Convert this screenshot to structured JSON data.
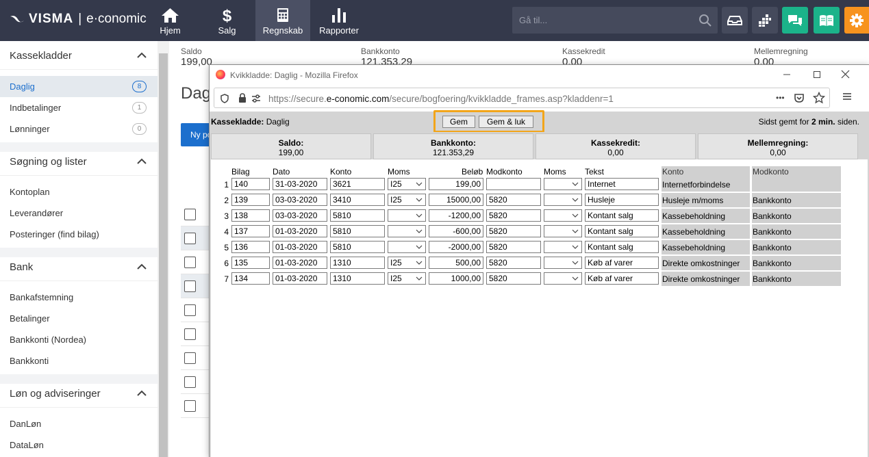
{
  "brand": {
    "visma": "VISMA",
    "sep": "|",
    "product": "e·conomic"
  },
  "nav": [
    {
      "label": "Hjem",
      "icon": "home-icon"
    },
    {
      "label": "Salg",
      "icon": "dollar-icon"
    },
    {
      "label": "Regnskab",
      "icon": "calculator-icon"
    },
    {
      "label": "Rapporter",
      "icon": "bar-chart-icon"
    }
  ],
  "search": {
    "placeholder": "Gå til..."
  },
  "sidebar": {
    "sections": [
      {
        "title": "Kassekladder",
        "items": [
          {
            "label": "Daglig",
            "badge": "8"
          },
          {
            "label": "Indbetalinger",
            "badge": "1"
          },
          {
            "label": "Lønninger",
            "badge": "0"
          }
        ]
      },
      {
        "title": "Søgning og lister",
        "items": [
          {
            "label": "Kontoplan"
          },
          {
            "label": "Leverandører"
          },
          {
            "label": "Posteringer (find bilag)"
          }
        ]
      },
      {
        "title": "Bank",
        "items": [
          {
            "label": "Bankafstemning"
          },
          {
            "label": "Betalinger"
          },
          {
            "label": "Bankkonti (Nordea)"
          },
          {
            "label": "Bankkonti"
          }
        ]
      },
      {
        "title": "Løn og adviseringer",
        "items": [
          {
            "label": "DanLøn"
          },
          {
            "label": "DataLøn"
          }
        ]
      }
    ]
  },
  "main": {
    "summary": [
      {
        "label": "Saldo",
        "value": "199,00"
      },
      {
        "label": "Bankkonto",
        "value": "121.353,29"
      },
      {
        "label": "Kassekredit",
        "value": "0,00"
      },
      {
        "label": "Mellemregning",
        "value": "0,00"
      }
    ],
    "title": "Daglig",
    "new_button": "Ny post"
  },
  "firefox": {
    "title": "Kvikkladde: Daglig - Mozilla Firefox",
    "url_prefix": "https://secure.",
    "url_domain": "e-conomic.com",
    "url_path": "/secure/bogfoering/kvikkladde_frames.asp?kladdenr=1",
    "dots": "•••"
  },
  "kvik": {
    "label_bold": "Kassekladde:",
    "label_value": " Daglig",
    "save": "Gem",
    "save_close": "Gem & luk",
    "saved_prefix": "Sidst gemt for ",
    "saved_bold": "2 min.",
    "saved_suffix": " siden.",
    "summary": [
      {
        "label": "Saldo:",
        "value": "199,00"
      },
      {
        "label": "Bankkonto:",
        "value": "121.353,29"
      },
      {
        "label": "Kassekredit:",
        "value": "0,00"
      },
      {
        "label": "Mellemregning:",
        "value": "0,00"
      }
    ],
    "headers": {
      "bilag": "Bilag",
      "dato": "Dato",
      "konto": "Konto",
      "moms": "Moms",
      "beloeb": "Beløb",
      "modkonto": "Modkonto",
      "moms2": "Moms",
      "tekst": "Tekst",
      "konto_name": "Konto",
      "modkonto_name": "Modkonto"
    },
    "rows": [
      {
        "n": "1",
        "bilag": "140",
        "dato": "31-03-2020",
        "konto": "3621",
        "moms": "I25",
        "beloeb": "199,00",
        "modkonto": "",
        "moms2": "",
        "tekst": "Internet",
        "konto_name": "Internetforbindelse",
        "modkonto_name": ""
      },
      {
        "n": "2",
        "bilag": "139",
        "dato": "03-03-2020",
        "konto": "3410",
        "moms": "I25",
        "beloeb": "15000,00",
        "modkonto": "5820",
        "moms2": "",
        "tekst": "Husleje",
        "konto_name": "Husleje m/moms",
        "modkonto_name": "Bankkonto"
      },
      {
        "n": "3",
        "bilag": "138",
        "dato": "03-03-2020",
        "konto": "5810",
        "moms": "",
        "beloeb": "-1200,00",
        "modkonto": "5820",
        "moms2": "",
        "tekst": "Kontant salg",
        "konto_name": "Kassebeholdning",
        "modkonto_name": "Bankkonto"
      },
      {
        "n": "4",
        "bilag": "137",
        "dato": "01-03-2020",
        "konto": "5810",
        "moms": "",
        "beloeb": "-600,00",
        "modkonto": "5820",
        "moms2": "",
        "tekst": "Kontant salg",
        "konto_name": "Kassebeholdning",
        "modkonto_name": "Bankkonto"
      },
      {
        "n": "5",
        "bilag": "136",
        "dato": "01-03-2020",
        "konto": "5810",
        "moms": "",
        "beloeb": "-2000,00",
        "modkonto": "5820",
        "moms2": "",
        "tekst": "Kontant salg",
        "konto_name": "Kassebeholdning",
        "modkonto_name": "Bankkonto"
      },
      {
        "n": "6",
        "bilag": "135",
        "dato": "01-03-2020",
        "konto": "1310",
        "moms": "I25",
        "beloeb": "500,00",
        "modkonto": "5820",
        "moms2": "",
        "tekst": "Køb af varer",
        "konto_name": "Direkte omkostninger",
        "modkonto_name": "Bankkonto"
      },
      {
        "n": "7",
        "bilag": "134",
        "dato": "01-03-2020",
        "konto": "1310",
        "moms": "I25",
        "beloeb": "1000,00",
        "modkonto": "5820",
        "moms2": "",
        "tekst": "Køb af varer",
        "konto_name": "Direkte omkostninger",
        "modkonto_name": "Bankkonto"
      }
    ]
  },
  "colors": {
    "topbar": "#34394b",
    "accent": "#1c6fcd",
    "chat": "#1bb38a",
    "settings": "#f7931e",
    "highlight": "#f2a51a"
  }
}
